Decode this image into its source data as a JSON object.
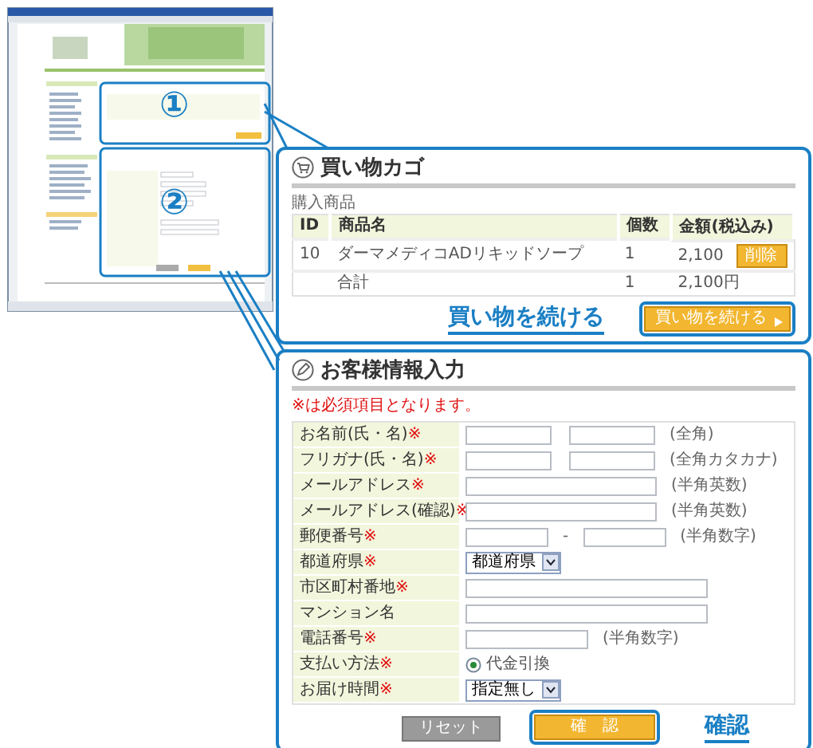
{
  "thumbnail": {
    "callouts": [
      "①",
      "②"
    ]
  },
  "cart": {
    "title": "買い物カゴ",
    "subheading": "購入商品",
    "columns": [
      "ID",
      "商品名",
      "個数",
      "金額(税込み)"
    ],
    "rows": [
      {
        "id": "10",
        "name": "ダーマメディコADリキッドソープ",
        "qty": "1",
        "price": "2,100",
        "action": "削除"
      }
    ],
    "total": {
      "label": "合計",
      "qty": "1",
      "price": "2,100円"
    },
    "callout": "買い物を続ける",
    "continue_button": "買い物を続ける"
  },
  "form": {
    "title": "お客様情報入力",
    "required_note": "※は必須項目となります。",
    "fields": [
      {
        "kind": "pair",
        "label": "お名前(氏・名)",
        "required_mark": "※",
        "hint": "(全角)"
      },
      {
        "kind": "pair",
        "label": "フリガナ(氏・名)",
        "required_mark": "※",
        "hint": "(全角カタカナ)"
      },
      {
        "kind": "text",
        "label": "メールアドレス",
        "required_mark": "※",
        "hint": "(半角英数)"
      },
      {
        "kind": "text",
        "label": "メールアドレス(確認)",
        "required_mark": "※",
        "hint": "(半角英数)"
      },
      {
        "kind": "zip",
        "label": "郵便番号",
        "required_mark": "※",
        "separator": "-",
        "hint": "(半角数字)"
      },
      {
        "kind": "select",
        "label": "都道府県",
        "required_mark": "※",
        "value": "都道府県"
      },
      {
        "kind": "long",
        "label": "市区町村番地",
        "required_mark": "※"
      },
      {
        "kind": "long",
        "label": "マンション名"
      },
      {
        "kind": "short",
        "label": "電話番号",
        "required_mark": "※",
        "hint": "(半角数字)"
      },
      {
        "kind": "radio",
        "label": "支払い方法",
        "required_mark": "※",
        "option": "代金引換",
        "selected": true
      },
      {
        "kind": "select",
        "label": "お届け時間",
        "required_mark": "※",
        "value": "指定無し"
      }
    ],
    "reset_button": "リセット",
    "confirm_button": "確　認",
    "callout": "確認"
  }
}
